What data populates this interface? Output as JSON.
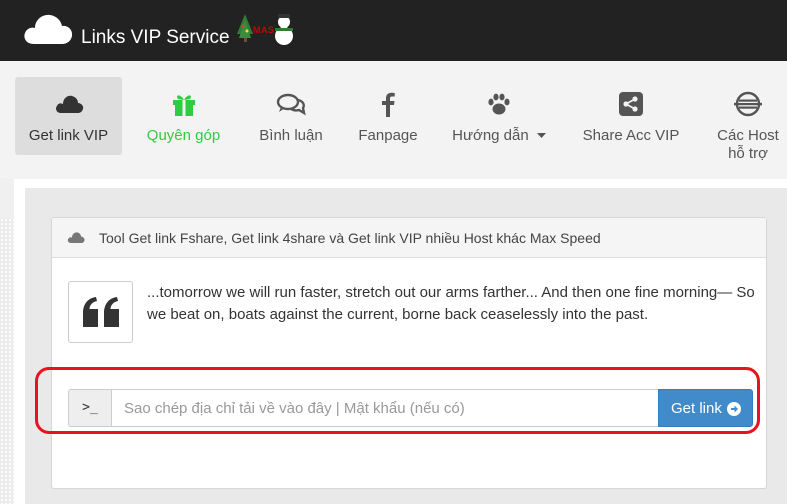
{
  "header": {
    "brand": "Links VIP Service",
    "xmas_text": "MAS"
  },
  "nav": {
    "items": [
      {
        "label": "Get link VIP",
        "icon": "cloud-icon",
        "active": true
      },
      {
        "label": "Quyên góp",
        "icon": "gift-icon",
        "color": "#2ecc40"
      },
      {
        "label": "Bình luận",
        "icon": "comments-icon"
      },
      {
        "label": "Fanpage",
        "icon": "facebook-icon"
      },
      {
        "label": "Hướng dẫn",
        "icon": "paw-icon",
        "dropdown": true
      },
      {
        "label": "Share Acc VIP",
        "icon": "share-icon"
      },
      {
        "label": "Các Host",
        "label2": "hỗ trợ",
        "icon": "server-list-icon"
      }
    ]
  },
  "panel": {
    "title": "Tool Get link Fshare, Get link 4share và Get link VIP nhiều Host khác Max Speed",
    "quote": "...tomorrow we will run faster, stretch out our arms farther... And then one fine morning— So we beat on, boats against the current, borne back ceaselessly into the past."
  },
  "form": {
    "addon": ">_",
    "placeholder": "Sao chép địa chỉ tải về vào đây | Mật khẩu (nếu có)",
    "value": "",
    "button": "Get link"
  },
  "colors": {
    "topbar": "#222222",
    "accent": "#428bca",
    "highlight": "#e8141b",
    "green": "#2ecc40"
  }
}
